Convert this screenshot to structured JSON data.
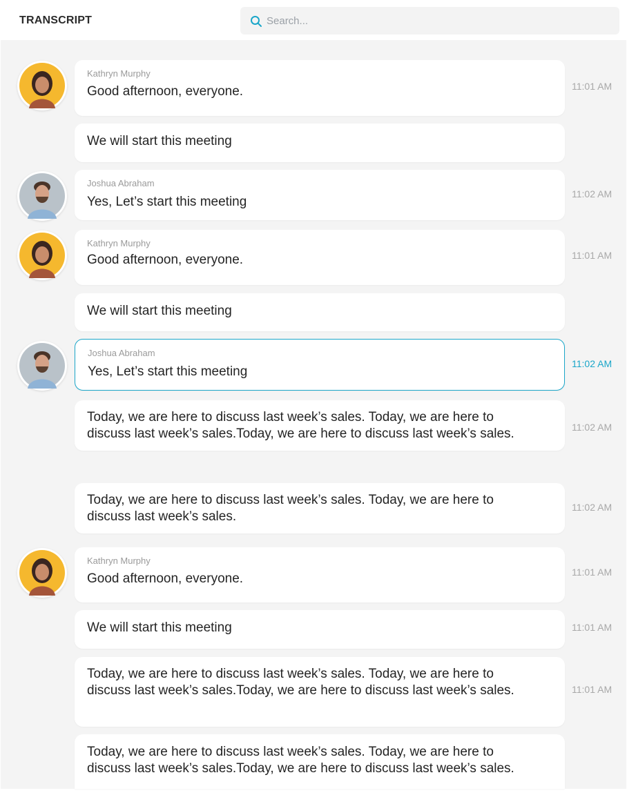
{
  "header": {
    "title": "TRANSCRIPT",
    "search_placeholder": "Search..."
  },
  "colors": {
    "accent": "#1aa6c9",
    "panel_bg": "#f4f4f4"
  },
  "messages": [
    {
      "speaker": "Kathryn Murphy",
      "text": "Good afternoon, everyone.",
      "time": "11:01 AM"
    },
    {
      "speaker": "",
      "text": "We will start this meeting",
      "time": ""
    },
    {
      "speaker": "Joshua Abraham",
      "text": "Yes, Let’s start this meeting",
      "time": "11:02 AM"
    },
    {
      "speaker": "Kathryn Murphy",
      "text": "Good afternoon, everyone.",
      "time": "11:01 AM"
    },
    {
      "speaker": "",
      "text": "We will start this meeting",
      "time": ""
    },
    {
      "speaker": "Joshua Abraham",
      "text": "Yes, Let’s start this meeting",
      "time": "11:02 AM",
      "active": true
    },
    {
      "speaker": "",
      "text": "Today, we are here to discuss last week’s sales. Today, we are here to discuss last week’s sales.Today, we are here to discuss last week’s sales.",
      "time": "11:02 AM"
    },
    {
      "speaker": "",
      "text": "Today, we are here to discuss last week’s sales. Today, we are here to discuss last week’s sales.",
      "time": "11:02 AM"
    },
    {
      "speaker": "Kathryn Murphy",
      "text": "Good afternoon, everyone.",
      "time": "11:01 AM"
    },
    {
      "speaker": "",
      "text": "We will start this meeting",
      "time": "11:01 AM"
    },
    {
      "speaker": "",
      "text": "Today, we are here to discuss last week’s sales. Today, we are here to discuss last week’s sales.Today, we are here to discuss last week’s sales.",
      "time": "11:01 AM"
    },
    {
      "speaker": "",
      "text": "Today, we are here to discuss last week’s sales. Today, we are here to discuss last week’s sales.Today, we are here to discuss last week’s sales.",
      "time": ""
    }
  ]
}
